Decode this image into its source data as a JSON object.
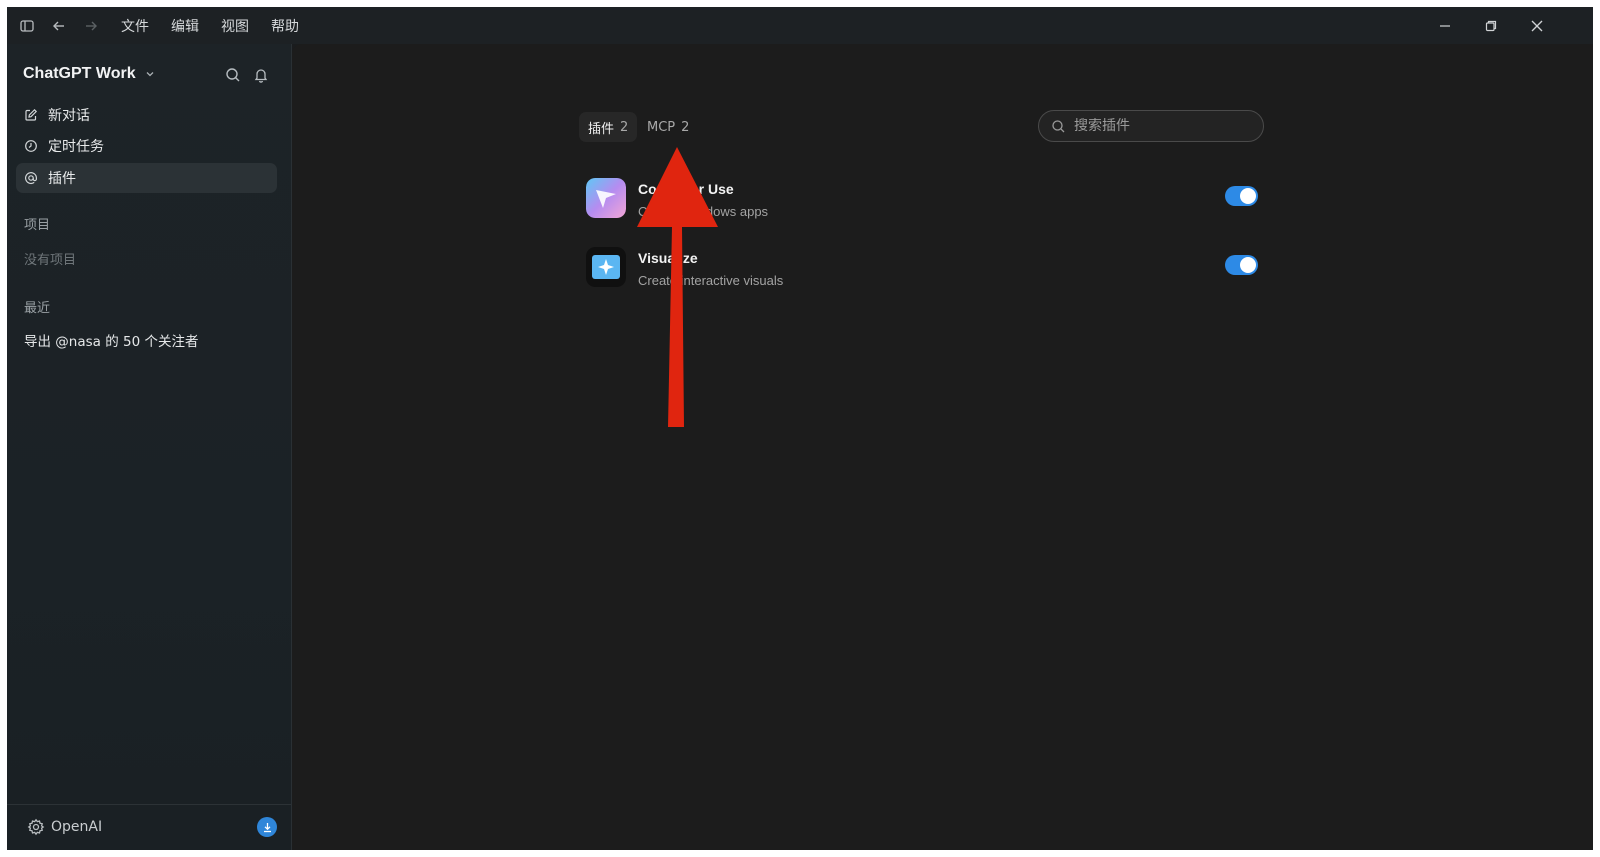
{
  "titlebar": {
    "menus": [
      "文件",
      "编辑",
      "视图",
      "帮助"
    ]
  },
  "sidebar": {
    "workspace_name": "ChatGPT Work",
    "nav": [
      {
        "label": "新对话",
        "icon": "edit-icon"
      },
      {
        "label": "定时任务",
        "icon": "clock-icon"
      },
      {
        "label": "插件",
        "icon": "at-icon",
        "active": true
      }
    ],
    "projects_label": "项目",
    "projects_empty": "没有项目",
    "recent_label": "最近",
    "recent_items": [
      "导出 @nasa 的 50 个关注者"
    ],
    "footer_label": "OpenAI"
  },
  "main": {
    "tabs": [
      {
        "label": "插件",
        "count": "2",
        "active": true
      },
      {
        "label": "MCP",
        "count": "2",
        "active": false
      }
    ],
    "search_placeholder": "搜索插件",
    "plugins": [
      {
        "title": "Computer Use",
        "desc": "Control Windows apps",
        "enabled": true,
        "icon": "computer-use-icon"
      },
      {
        "title": "Visualize",
        "desc": "Create interactive visuals",
        "enabled": true,
        "icon": "visualize-icon"
      }
    ]
  },
  "colors": {
    "accent": "#2d8ae6",
    "annotation_arrow": "#e0250f"
  }
}
